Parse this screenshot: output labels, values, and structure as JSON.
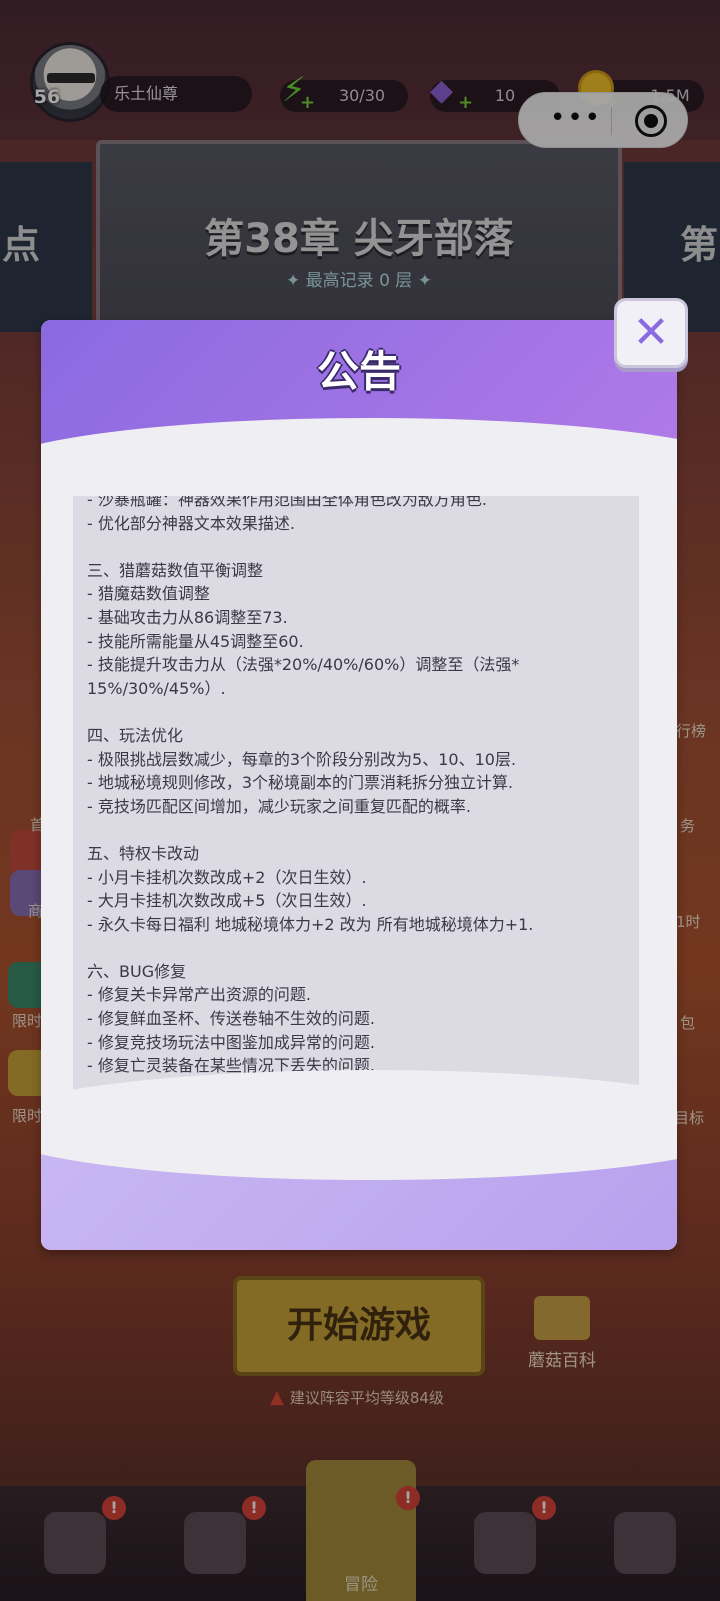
{
  "player": {
    "level": "56",
    "name": "乐土仙尊"
  },
  "resources": {
    "energy": "30/30",
    "gems": "10",
    "coins": "1.5M"
  },
  "capsule": {
    "more_glyph": "•••",
    "close_glyph": "◉"
  },
  "chapter": {
    "title": "第38章 尖牙部落",
    "record": "✦ 最高记录 0 层 ✦",
    "left_partial": "点",
    "right_partial": "第"
  },
  "side_menu": {
    "left": [
      "首",
      "商",
      "限时",
      "限时"
    ],
    "right": [
      "行榜",
      "务",
      "1时",
      "包",
      "目标"
    ]
  },
  "announcement": {
    "title": "公告",
    "close_glyph": "✕",
    "body": "- 沙暴瓶罐：神器效果作用范围由全体角色改为敌方角色.\n- 优化部分神器文本效果描述.\n\n三、猎蘑菇数值平衡调整\n- 猎魔菇数值调整\n- 基础攻击力从86调整至73.\n- 技能所需能量从45调整至60.\n- 技能提升攻击力从（法强*20%/40%/60%）调整至（法强*\n15%/30%/45%）.\n\n四、玩法优化\n- 极限挑战层数减少，每章的3个阶段分别改为5、10、10层.\n- 地城秘境规则修改，3个秘境副本的门票消耗拆分独立计算.\n- 竞技场匹配区间增加，减少玩家之间重复匹配的概率.\n\n五、特权卡改动\n- 小月卡挂机次数改成+2（次日生效）.\n- 大月卡挂机次数改成+5（次日生效）.\n- 永久卡每日福利 地城秘境体力+2 改为 所有地城秘境体力+1.\n\n六、BUG修复\n- 修复关卡异常产出资源的问题.\n- 修复鲜血圣杯、传送卷轴不生效的问题.\n- 修复竞技场玩法中图鉴加成异常的问题.\n- 修复亡灵装备在某些情况下丢失的问题.\n\n请召唤师们遵循游戏公平原则，检测游戏作弊行为将永久封禁账\n号，"
  },
  "bottom": {
    "start_label": "开始游戏",
    "wiki_label": "蘑菇百科",
    "hint": "建议阵容平均等级84级",
    "warn_glyph": "▲",
    "adventure_label": "冒险",
    "badge": "!"
  },
  "colors": {
    "accent_purple": "#8a6ae0",
    "badge_red": "#d9443a",
    "energy_green": "#6ed63a"
  }
}
